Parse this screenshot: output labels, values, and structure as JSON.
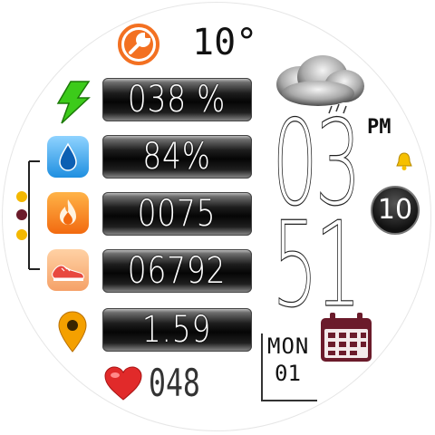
{
  "weather": {
    "temperature": "10°",
    "condition_icon": "rain-cloud-icon"
  },
  "metrics": {
    "battery": "038 %",
    "humidity": "84%",
    "calories": "0075",
    "steps": "06792",
    "distance": "1.59"
  },
  "time": {
    "hour": "03",
    "minute": "51",
    "ampm": "PM"
  },
  "date": {
    "weekday": "MON",
    "day": "01",
    "calendar_badge": "10"
  },
  "heart_rate": "048",
  "colors": {
    "orange": "#f37021",
    "battery_green": "#3ccb1a",
    "alarm_yellow": "#f6c000",
    "calendar_maroon": "#6b1b2b",
    "heart_red": "#e12a2a",
    "location_orange": "#f4a000"
  }
}
